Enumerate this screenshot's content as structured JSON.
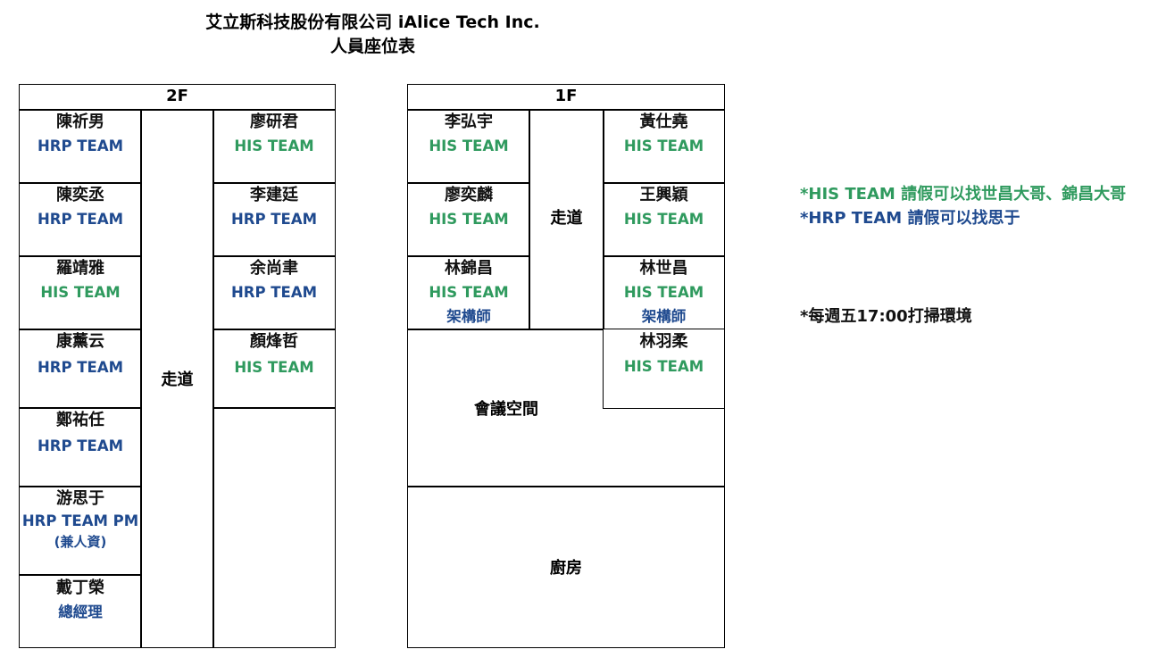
{
  "header": {
    "title_line1": "艾立斯科技股份有限公司 iAlice Tech Inc.",
    "title_line2": "人員座位表"
  },
  "colors": {
    "his_team": "#2f9a5e",
    "hrp_team": "#1f4a8f"
  },
  "floor2": {
    "label": "2F",
    "aisle_label": "走道",
    "left_seats": [
      {
        "name": "陳祈男",
        "team": "HRP TEAM"
      },
      {
        "name": "陳奕丞",
        "team": "HRP TEAM"
      },
      {
        "name": "羅靖雅",
        "team": "HIS TEAM"
      },
      {
        "name": "康薰云",
        "team": "HRP TEAM"
      },
      {
        "name": "鄭祐任",
        "team": "HRP TEAM"
      },
      {
        "name": "游思于",
        "team": "HRP TEAM PM",
        "note": "(兼人資)"
      },
      {
        "name": "戴丁榮",
        "title": "總經理"
      }
    ],
    "right_seats": [
      {
        "name": "廖研君",
        "team": "HIS TEAM"
      },
      {
        "name": "李建廷",
        "team": "HRP TEAM"
      },
      {
        "name": "余尚聿",
        "team": "HRP TEAM"
      },
      {
        "name": "顏烽哲",
        "team": "HIS TEAM"
      }
    ]
  },
  "floor1": {
    "label": "1F",
    "aisle_label": "走道",
    "meeting_room_label": "會議空間",
    "kitchen_label": "廚房",
    "left_seats": [
      {
        "name": "李弘宇",
        "team": "HIS TEAM"
      },
      {
        "name": "廖奕麟",
        "team": "HIS TEAM"
      },
      {
        "name": "林錦昌",
        "team": "HIS TEAM",
        "title": "架構師"
      }
    ],
    "right_seats": [
      {
        "name": "黃仕堯",
        "team": "HIS TEAM"
      },
      {
        "name": "王興穎",
        "team": "HIS TEAM"
      },
      {
        "name": "林世昌",
        "team": "HIS TEAM",
        "title": "架構師"
      },
      {
        "name": "林羽柔",
        "team": "HIS TEAM"
      }
    ]
  },
  "notes": {
    "his_leave": "*HIS TEAM 請假可以找世昌大哥、錦昌大哥",
    "hrp_leave": "*HRP TEAM 請假可以找思于",
    "cleaning": "*每週五17:00打掃環境"
  }
}
